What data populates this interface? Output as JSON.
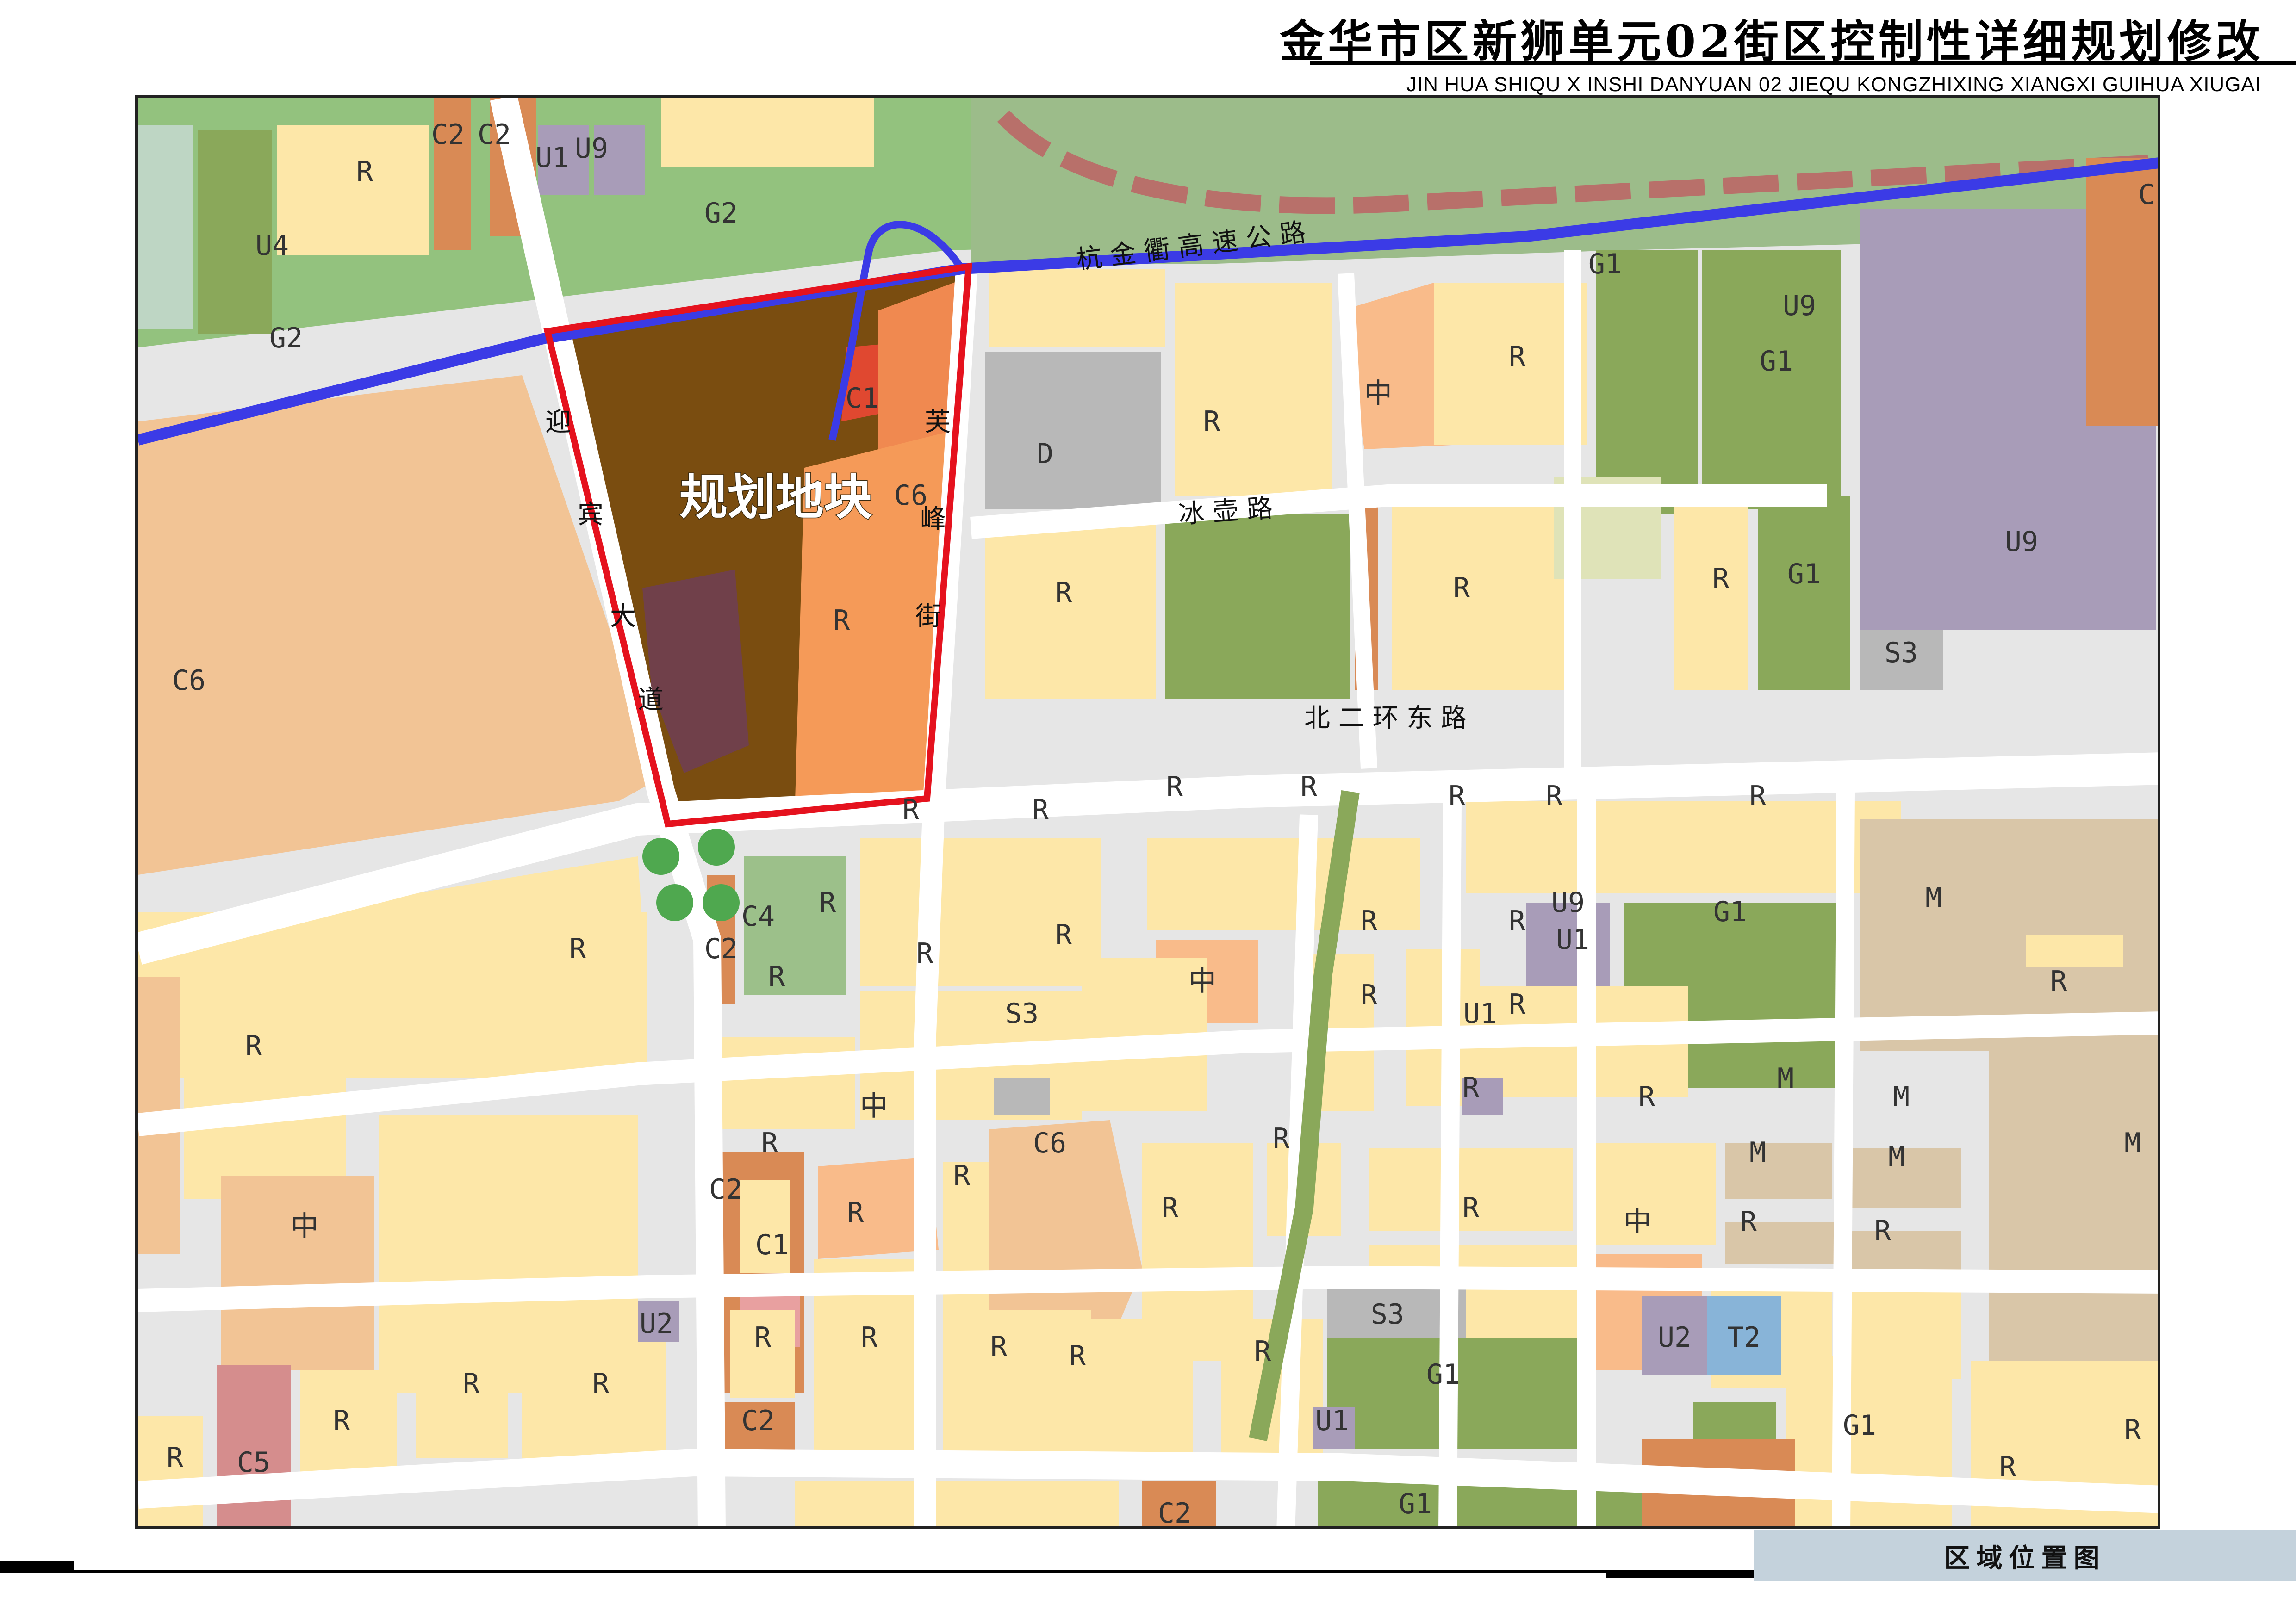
{
  "header": {
    "title_cn": "金华市区新狮单元02街区控制性详细规划修改",
    "title_en": "JIN HUA SHIQU  X INSHI  DANYUAN 02 JIEQU  KONGZHIXING  XIANGXI  GUIHUA  XIUGAI"
  },
  "footer": {
    "caption": "区域位置图"
  },
  "map": {
    "site_label": "规划地块",
    "roads": {
      "highway": "杭 金 衢 高 速 公 路",
      "bingpu": "冰     壶     路",
      "beierhuan": "北   二   环   东   路",
      "yingbin_chars": [
        "迎",
        "宾",
        "大",
        "道"
      ],
      "furong_chars": [
        "芙",
        "峰",
        "街"
      ]
    },
    "parcel_codes": {
      "site": [
        "C1",
        "C6",
        "R"
      ],
      "top_area": [
        "R",
        "C2",
        "C2",
        "U1",
        "U9",
        "U4",
        "G2",
        "G2",
        "C6",
        "D",
        "R",
        "R",
        "R",
        "G1",
        "G1",
        "U9",
        "U9",
        "R",
        "G1",
        "S3",
        "R",
        "中",
        "C"
      ],
      "middle_area": [
        "R",
        "C4",
        "C2",
        "R",
        "R",
        "R",
        "R",
        "中",
        "R",
        "R",
        "R",
        "R",
        "R",
        "U9",
        "U1",
        "R",
        "G1",
        "M",
        "R",
        "R",
        "S3",
        "R",
        "R",
        "U1",
        "R"
      ],
      "lower_area": [
        "R",
        "中",
        "R",
        "C2",
        "C1",
        "R",
        "中",
        "C6",
        "R",
        "R",
        "R",
        "R",
        "R",
        "R",
        "R",
        "M",
        "M",
        "M",
        "M",
        "M",
        "中",
        "R",
        "R"
      ],
      "bottom_area": [
        "U2",
        "R",
        "R",
        "R",
        "C5",
        "R",
        "R",
        "C2",
        "R",
        "R",
        "R",
        "R",
        "S3",
        "G1",
        "U1",
        "U2",
        "T2",
        "G1",
        "R",
        "R",
        "G1",
        "C2"
      ]
    },
    "colors": {
      "residential": "#fde7a8",
      "commercial_c6": "#f2c495",
      "green_g1": "#8aa85a",
      "green_g2": "#95c484",
      "utility_u9": "#a89cb8",
      "industrial_m": "#d9c6a8",
      "road": "#e8e8e8",
      "highway": "#3b3be6",
      "site_boundary": "#e5121e",
      "site_fill": "#7a4d10"
    }
  }
}
